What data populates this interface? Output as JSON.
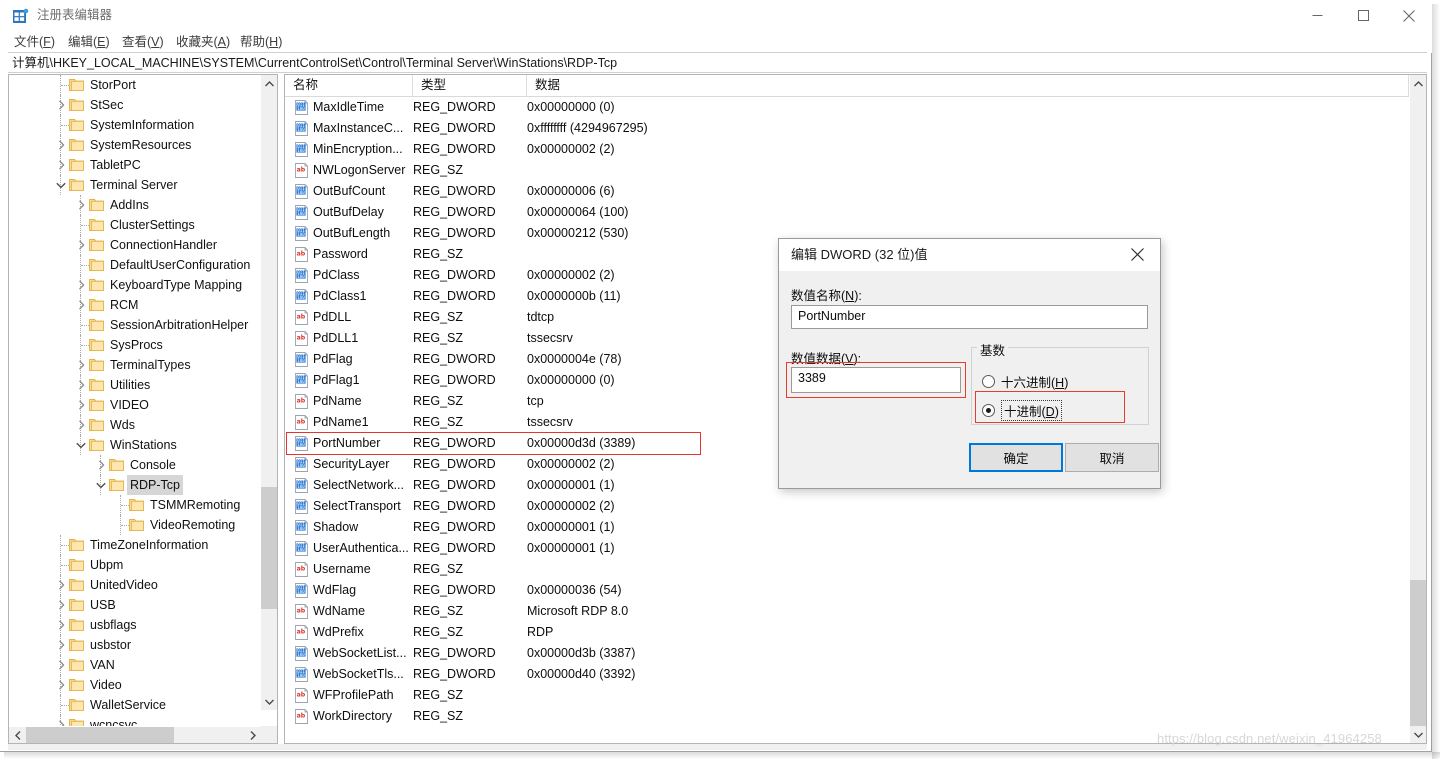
{
  "window": {
    "title": "注册表编辑器",
    "app_icon": "registry-editor-icon",
    "minimize_label": "最小化",
    "maximize_label": "最大化",
    "close_label": "关闭"
  },
  "menubar": {
    "items": [
      {
        "label": "文件(F)",
        "accel": "F",
        "text_before": "文件(",
        "text_after": ")"
      },
      {
        "label": "编辑(E)",
        "accel": "E",
        "text_before": "编辑(",
        "text_after": ")"
      },
      {
        "label": "查看(V)",
        "accel": "V",
        "text_before": "查看(",
        "text_after": ")"
      },
      {
        "label": "收藏夹(A)",
        "accel": "A",
        "text_before": "收藏夹(",
        "text_after": ")"
      },
      {
        "label": "帮助(H)",
        "accel": "H",
        "text_before": "帮助(",
        "text_after": ")"
      }
    ]
  },
  "address": {
    "path": "计算机\\HKEY_LOCAL_MACHINE\\SYSTEM\\CurrentControlSet\\Control\\Terminal Server\\WinStations\\RDP-Tcp"
  },
  "tree": {
    "items": [
      {
        "label": "StorPort",
        "depth": 3,
        "expander": "none",
        "selected": false
      },
      {
        "label": "StSec",
        "depth": 3,
        "expander": "collapsed",
        "selected": false
      },
      {
        "label": "SystemInformation",
        "depth": 3,
        "expander": "none",
        "selected": false
      },
      {
        "label": "SystemResources",
        "depth": 3,
        "expander": "collapsed",
        "selected": false
      },
      {
        "label": "TabletPC",
        "depth": 3,
        "expander": "collapsed",
        "selected": false
      },
      {
        "label": "Terminal Server",
        "depth": 3,
        "expander": "expanded",
        "selected": false
      },
      {
        "label": "AddIns",
        "depth": 4,
        "expander": "collapsed",
        "selected": false
      },
      {
        "label": "ClusterSettings",
        "depth": 4,
        "expander": "none",
        "selected": false
      },
      {
        "label": "ConnectionHandler",
        "depth": 4,
        "expander": "collapsed",
        "selected": false
      },
      {
        "label": "DefaultUserConfiguration",
        "depth": 4,
        "expander": "none",
        "selected": false
      },
      {
        "label": "KeyboardType Mapping",
        "depth": 4,
        "expander": "collapsed",
        "selected": false
      },
      {
        "label": "RCM",
        "depth": 4,
        "expander": "collapsed",
        "selected": false
      },
      {
        "label": "SessionArbitrationHelper",
        "depth": 4,
        "expander": "none",
        "selected": false
      },
      {
        "label": "SysProcs",
        "depth": 4,
        "expander": "none",
        "selected": false
      },
      {
        "label": "TerminalTypes",
        "depth": 4,
        "expander": "collapsed",
        "selected": false
      },
      {
        "label": "Utilities",
        "depth": 4,
        "expander": "collapsed",
        "selected": false
      },
      {
        "label": "VIDEO",
        "depth": 4,
        "expander": "collapsed",
        "selected": false
      },
      {
        "label": "Wds",
        "depth": 4,
        "expander": "collapsed",
        "selected": false
      },
      {
        "label": "WinStations",
        "depth": 4,
        "expander": "expanded",
        "selected": false
      },
      {
        "label": "Console",
        "depth": 5,
        "expander": "collapsed",
        "selected": false
      },
      {
        "label": "RDP-Tcp",
        "depth": 5,
        "expander": "expanded",
        "selected": true
      },
      {
        "label": "TSMMRemoting",
        "depth": 6,
        "expander": "none",
        "selected": false
      },
      {
        "label": "VideoRemoting",
        "depth": 6,
        "expander": "none",
        "selected": false
      },
      {
        "label": "TimeZoneInformation",
        "depth": 3,
        "expander": "none",
        "selected": false
      },
      {
        "label": "Ubpm",
        "depth": 3,
        "expander": "none",
        "selected": false
      },
      {
        "label": "UnitedVideo",
        "depth": 3,
        "expander": "collapsed",
        "selected": false
      },
      {
        "label": "USB",
        "depth": 3,
        "expander": "collapsed",
        "selected": false
      },
      {
        "label": "usbflags",
        "depth": 3,
        "expander": "collapsed",
        "selected": false
      },
      {
        "label": "usbstor",
        "depth": 3,
        "expander": "collapsed",
        "selected": false
      },
      {
        "label": "VAN",
        "depth": 3,
        "expander": "collapsed",
        "selected": false
      },
      {
        "label": "Video",
        "depth": 3,
        "expander": "collapsed",
        "selected": false
      },
      {
        "label": "WalletService",
        "depth": 3,
        "expander": "none",
        "selected": false
      },
      {
        "label": "wcncsvc",
        "depth": 3,
        "expander": "collapsed",
        "selected": false
      }
    ]
  },
  "list": {
    "columns": [
      {
        "label": "名称",
        "key": "name"
      },
      {
        "label": "类型",
        "key": "type"
      },
      {
        "label": "数据",
        "key": "data"
      }
    ],
    "rows": [
      {
        "name": "MaxIdleTime",
        "type": "REG_DWORD",
        "data": "0x00000000 (0)",
        "icon": "dword-icon",
        "highlighted": false
      },
      {
        "name": "MaxInstanceC...",
        "type": "REG_DWORD",
        "data": "0xffffffff (4294967295)",
        "icon": "dword-icon",
        "highlighted": false
      },
      {
        "name": "MinEncryption...",
        "type": "REG_DWORD",
        "data": "0x00000002 (2)",
        "icon": "dword-icon",
        "highlighted": false
      },
      {
        "name": "NWLogonServer",
        "type": "REG_SZ",
        "data": "",
        "icon": "string-icon",
        "highlighted": false
      },
      {
        "name": "OutBufCount",
        "type": "REG_DWORD",
        "data": "0x00000006 (6)",
        "icon": "dword-icon",
        "highlighted": false
      },
      {
        "name": "OutBufDelay",
        "type": "REG_DWORD",
        "data": "0x00000064 (100)",
        "icon": "dword-icon",
        "highlighted": false
      },
      {
        "name": "OutBufLength",
        "type": "REG_DWORD",
        "data": "0x00000212 (530)",
        "icon": "dword-icon",
        "highlighted": false
      },
      {
        "name": "Password",
        "type": "REG_SZ",
        "data": "",
        "icon": "string-icon",
        "highlighted": false
      },
      {
        "name": "PdClass",
        "type": "REG_DWORD",
        "data": "0x00000002 (2)",
        "icon": "dword-icon",
        "highlighted": false
      },
      {
        "name": "PdClass1",
        "type": "REG_DWORD",
        "data": "0x0000000b (11)",
        "icon": "dword-icon",
        "highlighted": false
      },
      {
        "name": "PdDLL",
        "type": "REG_SZ",
        "data": "tdtcp",
        "icon": "string-icon",
        "highlighted": false
      },
      {
        "name": "PdDLL1",
        "type": "REG_SZ",
        "data": "tssecsrv",
        "icon": "string-icon",
        "highlighted": false
      },
      {
        "name": "PdFlag",
        "type": "REG_DWORD",
        "data": "0x0000004e (78)",
        "icon": "dword-icon",
        "highlighted": false
      },
      {
        "name": "PdFlag1",
        "type": "REG_DWORD",
        "data": "0x00000000 (0)",
        "icon": "dword-icon",
        "highlighted": false
      },
      {
        "name": "PdName",
        "type": "REG_SZ",
        "data": "tcp",
        "icon": "string-icon",
        "highlighted": false
      },
      {
        "name": "PdName1",
        "type": "REG_SZ",
        "data": "tssecsrv",
        "icon": "string-icon",
        "highlighted": false
      },
      {
        "name": "PortNumber",
        "type": "REG_DWORD",
        "data": "0x00000d3d (3389)",
        "icon": "dword-icon",
        "highlighted": true
      },
      {
        "name": "SecurityLayer",
        "type": "REG_DWORD",
        "data": "0x00000002 (2)",
        "icon": "dword-icon",
        "highlighted": false
      },
      {
        "name": "SelectNetwork...",
        "type": "REG_DWORD",
        "data": "0x00000001 (1)",
        "icon": "dword-icon",
        "highlighted": false
      },
      {
        "name": "SelectTransport",
        "type": "REG_DWORD",
        "data": "0x00000002 (2)",
        "icon": "dword-icon",
        "highlighted": false
      },
      {
        "name": "Shadow",
        "type": "REG_DWORD",
        "data": "0x00000001 (1)",
        "icon": "dword-icon",
        "highlighted": false
      },
      {
        "name": "UserAuthentica...",
        "type": "REG_DWORD",
        "data": "0x00000001 (1)",
        "icon": "dword-icon",
        "highlighted": false
      },
      {
        "name": "Username",
        "type": "REG_SZ",
        "data": "",
        "icon": "string-icon",
        "highlighted": false
      },
      {
        "name": "WdFlag",
        "type": "REG_DWORD",
        "data": "0x00000036 (54)",
        "icon": "dword-icon",
        "highlighted": false
      },
      {
        "name": "WdName",
        "type": "REG_SZ",
        "data": "Microsoft RDP 8.0",
        "icon": "string-icon",
        "highlighted": false
      },
      {
        "name": "WdPrefix",
        "type": "REG_SZ",
        "data": "RDP",
        "icon": "string-icon",
        "highlighted": false
      },
      {
        "name": "WebSocketList...",
        "type": "REG_DWORD",
        "data": "0x00000d3b (3387)",
        "icon": "dword-icon",
        "highlighted": false
      },
      {
        "name": "WebSocketTls...",
        "type": "REG_DWORD",
        "data": "0x00000d40 (3392)",
        "icon": "dword-icon",
        "highlighted": false
      },
      {
        "name": "WFProfilePath",
        "type": "REG_SZ",
        "data": "",
        "icon": "string-icon",
        "highlighted": false
      },
      {
        "name": "WorkDirectory",
        "type": "REG_SZ",
        "data": "",
        "icon": "string-icon",
        "highlighted": false
      }
    ]
  },
  "dialog": {
    "title": "编辑 DWORD (32 位)值",
    "close_label": "关闭",
    "name_label": "数值名称(N):",
    "name_value": "PortNumber",
    "data_label": "数值数据(V):",
    "data_value": "3389",
    "base_group_title": "基数",
    "radios": [
      {
        "label": "十六进制(H)",
        "checked": false,
        "focused": false
      },
      {
        "label": "十进制(D)",
        "checked": true,
        "focused": true
      }
    ],
    "ok_label": "确定",
    "cancel_label": "取消"
  },
  "watermark": {
    "text": "https://blog.csdn.net/weixin_41964258"
  },
  "colors": {
    "accent": "#0078d7",
    "highlight_red": "#ec3a2e",
    "folder_yellow": "#fcd88b",
    "selection_gray": "#d6d6d6"
  }
}
